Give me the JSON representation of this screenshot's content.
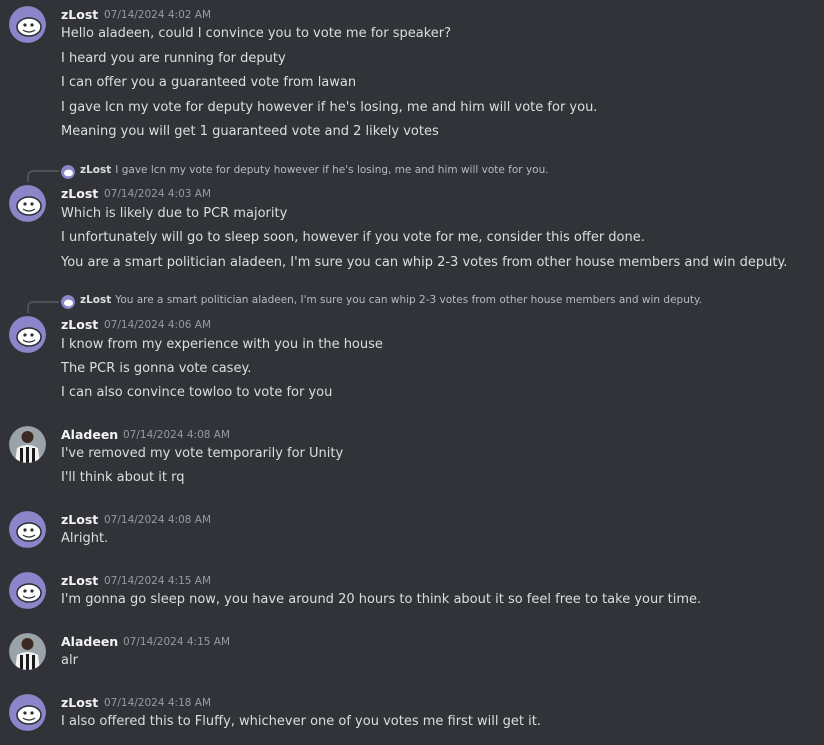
{
  "messages": [
    {
      "author": "zLost",
      "timestamp": "07/14/2024 4:02 AM",
      "avatar": "zlost-avatar",
      "lines": [
        "Hello aladeen, could I convince you to vote me for speaker?",
        "I heard you are running for deputy",
        "I can offer you a guaranteed vote from lawan",
        "I gave lcn my vote for deputy however if he's losing, me and him will vote for you.",
        "Meaning you will get 1 guaranteed vote and 2 likely votes"
      ]
    },
    {
      "author": "zLost",
      "timestamp": "07/14/2024 4:03 AM",
      "avatar": "zlost-avatar",
      "reply": {
        "author": "zLost",
        "text": "I gave lcn my vote for deputy however if he's losing, me and him will vote for you."
      },
      "lines": [
        "Which is likely due to PCR majority",
        "I unfortunately will go to sleep soon, however if you vote for me, consider this offer done.",
        "You are a smart politician aladeen, I'm sure you can whip 2-3 votes from other house members and win deputy."
      ]
    },
    {
      "author": "zLost",
      "timestamp": "07/14/2024 4:06 AM",
      "avatar": "zlost-avatar",
      "reply": {
        "author": "zLost",
        "text": "You are a smart politician aladeen, I'm sure you can whip 2-3 votes from other house members and win deputy."
      },
      "lines": [
        "I know from my experience with you in the house",
        "The PCR is gonna vote casey.",
        "I can also convince towloo to vote for you"
      ]
    },
    {
      "author": "Aladeen",
      "timestamp": "07/14/2024 4:08 AM",
      "avatar": "aladeen-avatar",
      "lines": [
        "I've removed my vote temporarily for Unity",
        "I'll think about it rq"
      ]
    },
    {
      "author": "zLost",
      "timestamp": "07/14/2024 4:08 AM",
      "avatar": "zlost-avatar",
      "lines": [
        "Alright."
      ]
    },
    {
      "author": "zLost",
      "timestamp": "07/14/2024 4:15 AM",
      "avatar": "zlost-avatar",
      "lines": [
        "I'm gonna go sleep now, you have around 20 hours to think about it so feel free to take your time."
      ]
    },
    {
      "author": "Aladeen",
      "timestamp": "07/14/2024 4:15 AM",
      "avatar": "aladeen-avatar",
      "lines": [
        "alr"
      ]
    },
    {
      "author": "zLost",
      "timestamp": "07/14/2024 4:18 AM",
      "avatar": "zlost-avatar",
      "lines": [
        "I also offered this to Fluffy, whichever one of you votes me first will get it."
      ]
    }
  ],
  "colors": {
    "background": "#313338",
    "author_name": "#f2f3f5",
    "timestamp": "#949ba4",
    "message_text": "#dbdee1",
    "zlost_avatar_bg": "#8b85c9"
  }
}
